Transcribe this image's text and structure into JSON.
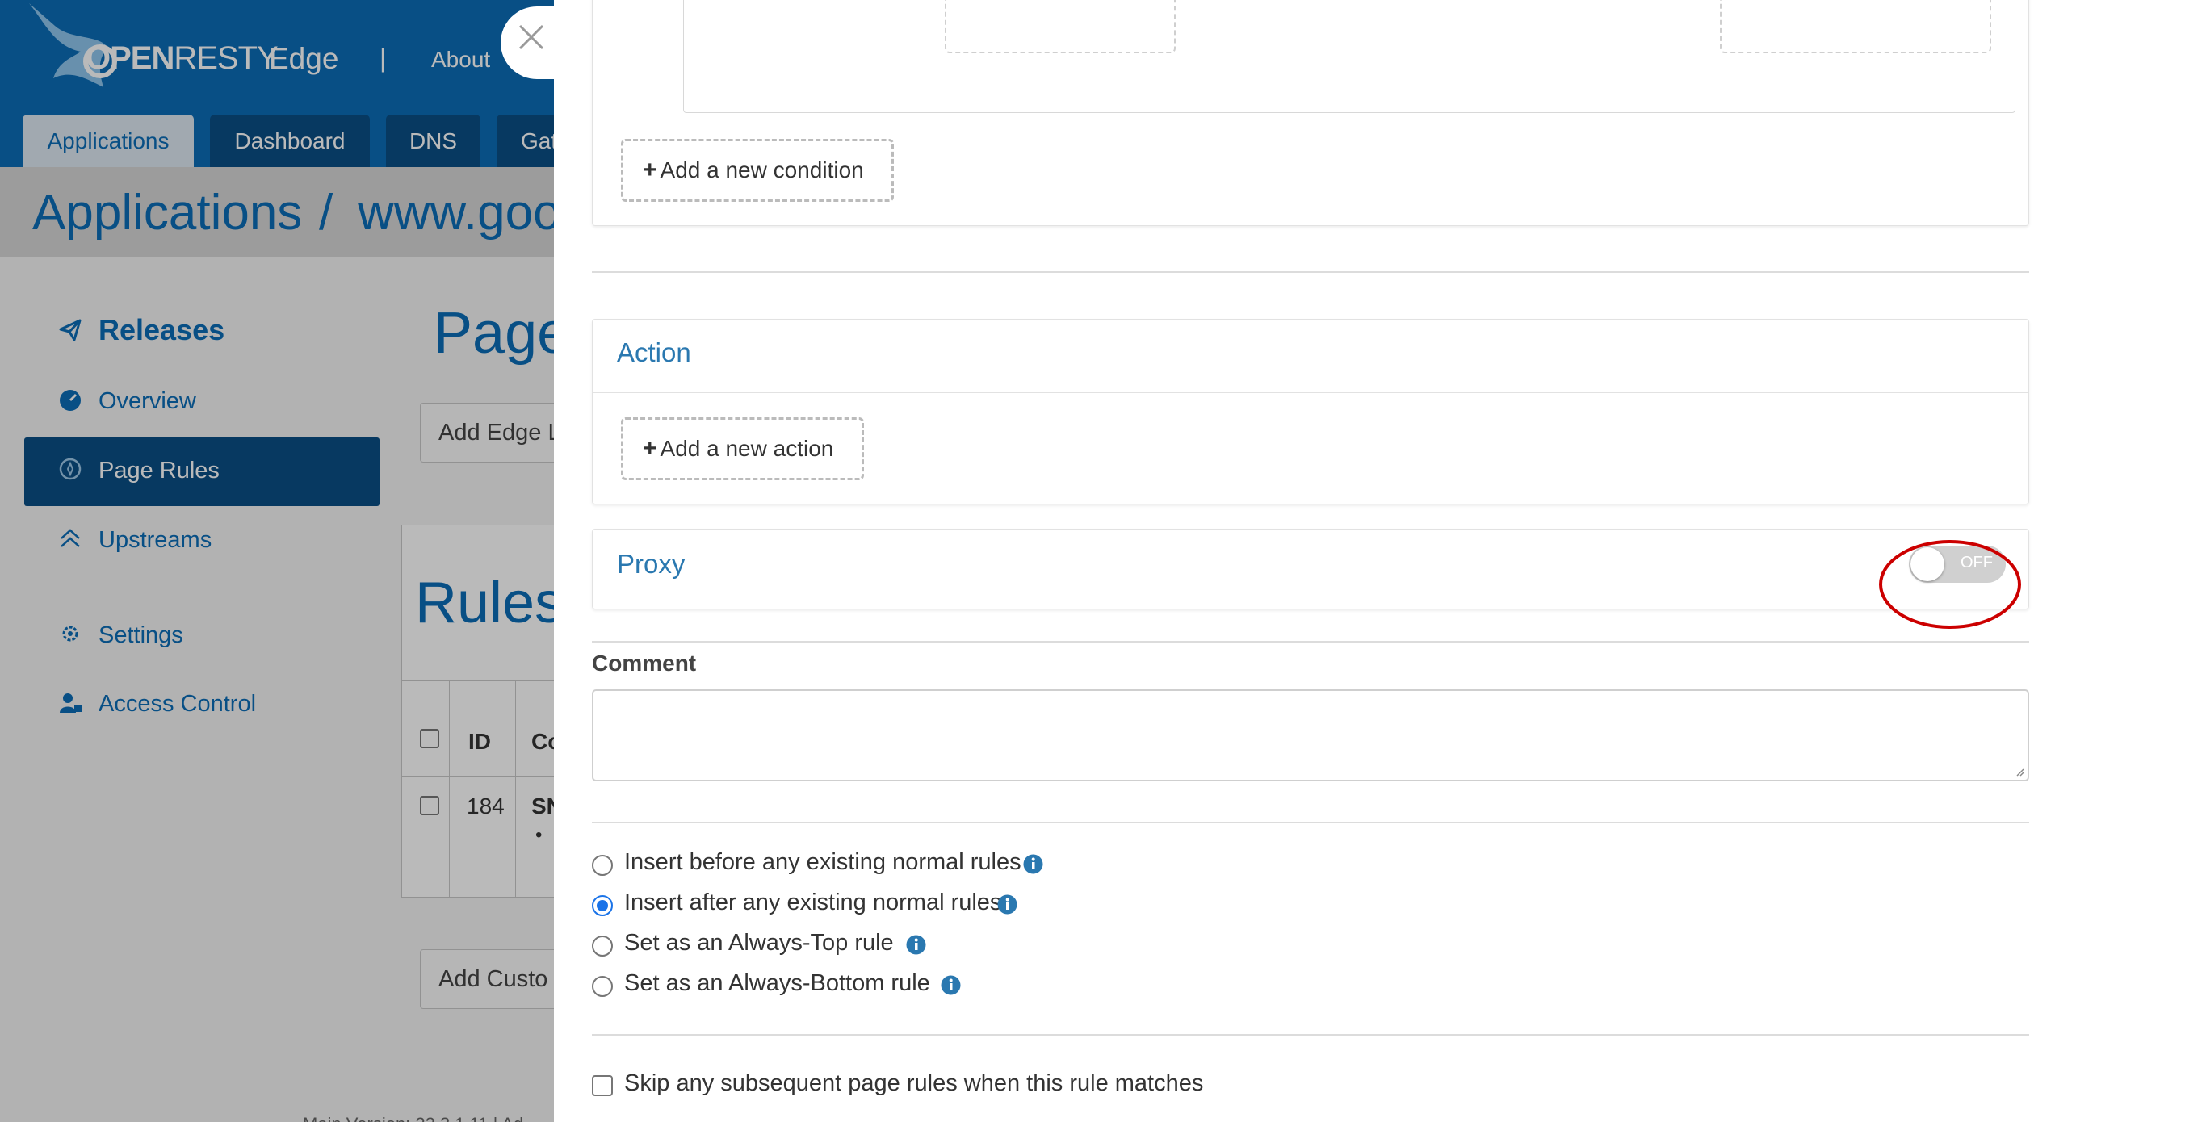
{
  "header": {
    "logo_text": "OPENRESTY",
    "logo_open": "OPEN",
    "logo_resty": "RESTY",
    "product": "Edge",
    "separator": "|",
    "about": "About"
  },
  "tabs": [
    {
      "label": "Applications"
    },
    {
      "label": "Dashboard"
    },
    {
      "label": "DNS"
    },
    {
      "label": "Gat"
    }
  ],
  "breadcrumb": {
    "root": "Applications",
    "sep": "/",
    "current": "www.goo"
  },
  "sidebar": {
    "items": [
      {
        "label": "Releases",
        "icon": "paper-plane-icon"
      },
      {
        "label": "Overview",
        "icon": "dashboard-icon"
      },
      {
        "label": "Page Rules",
        "icon": "compass-icon"
      },
      {
        "label": "Upstreams",
        "icon": "chevron-up-icon"
      },
      {
        "label": "Settings",
        "icon": "gear-icon"
      },
      {
        "label": "Access Control",
        "icon": "user-lock-icon"
      }
    ]
  },
  "main": {
    "page_title": "Page",
    "add_edge_button": "Add Edge L",
    "rules_title": "Rules",
    "table": {
      "headers": [
        "ID",
        "Co"
      ],
      "rows": [
        {
          "id": "184",
          "c": "SN",
          "bullet": "•"
        }
      ]
    },
    "add_custom_button": "Add Custo",
    "footer_version": "Main Version: 22.3.1.11 | Ad"
  },
  "drawer": {
    "add_condition": "Add a new condition",
    "action_title": "Action",
    "add_action": "Add a new action",
    "proxy_title": "Proxy",
    "proxy_toggle": {
      "state": "OFF",
      "on": false
    },
    "comment_label": "Comment",
    "comment_value": "",
    "insert_options": [
      {
        "label": "Insert before any existing normal rules",
        "checked": false
      },
      {
        "label": "Insert after any existing normal rules",
        "checked": true
      },
      {
        "label": "Set as an Always-Top rule",
        "checked": false
      },
      {
        "label": "Set as an Always-Bottom rule",
        "checked": false
      }
    ],
    "skip_checkbox": {
      "label": "Skip any subsequent page rules when this rule matches",
      "checked": false
    }
  },
  "colors": {
    "brand_blue": "#0b6db7",
    "sidebar_active": "#0a4f86",
    "radio_checked": "#1a73e8",
    "highlight": "#cc0000"
  }
}
